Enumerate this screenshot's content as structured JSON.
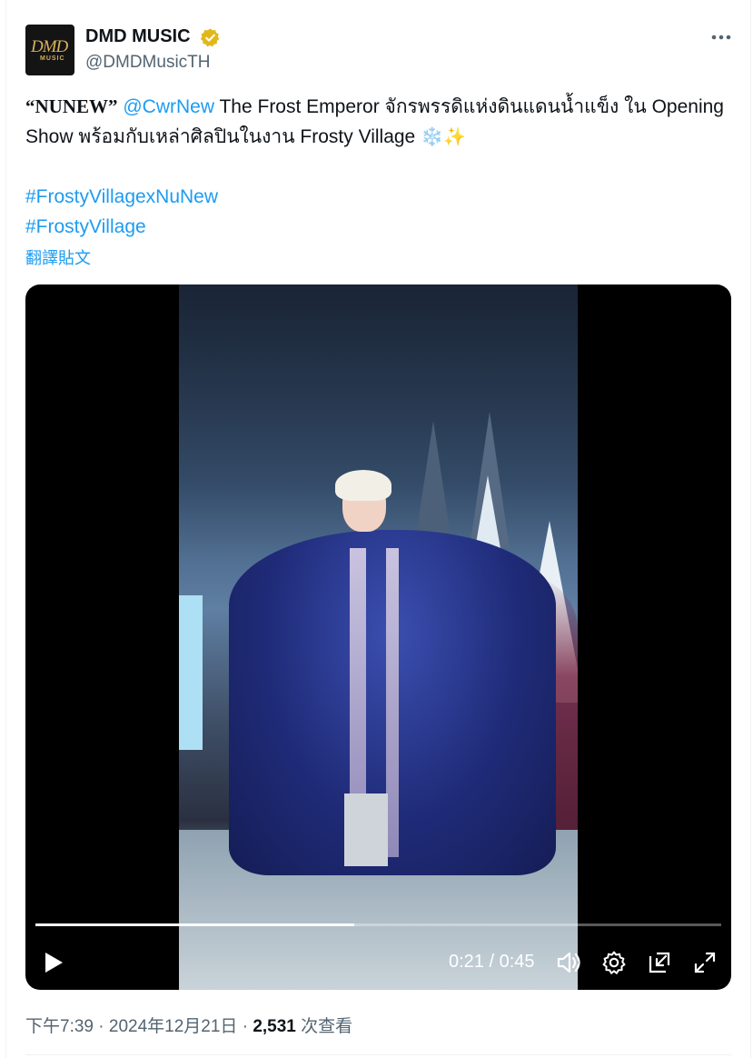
{
  "author": {
    "avatar_text_line1": "DMD",
    "avatar_text_line2": "MUSIC",
    "name": "DMD MUSIC",
    "handle": "@DMDMusicTH",
    "verified_icon": "gold-verified-badge-icon",
    "verified_color": "#e2b719"
  },
  "tweet": {
    "lead": "“NUNEW”",
    "mention": "@CwrNew",
    "text_part1": " The Frost Emperor จักรพรรดิแห่งดินแดนน้ำแข็ง ใน Opening Show พร้อมกับเหล่าศิลปินในงาน Frosty Village ",
    "emoji_snow": "❄️",
    "emoji_sparkle": "✨",
    "hashtags": [
      "#FrostyVillagexNuNew",
      "#FrostyVillage"
    ],
    "translate_label": "翻譯貼文"
  },
  "video": {
    "current_time": "0:21",
    "separator": " / ",
    "duration": "0:45",
    "progress": 0.465,
    "controls": {
      "play_icon": "play-icon",
      "volume_icon": "volume-icon",
      "settings_icon": "gear-icon",
      "pip_icon": "picture-in-picture-icon",
      "fullscreen_icon": "fullscreen-icon"
    }
  },
  "meta": {
    "time": "下午7:39",
    "dot1": " · ",
    "date": "2024年12月21日",
    "dot2": " · ",
    "views_count": "2,531",
    "views_label": " 次查看"
  },
  "colors": {
    "accent": "#1d9bf0",
    "text": "#0f1419",
    "muted": "#536471"
  }
}
